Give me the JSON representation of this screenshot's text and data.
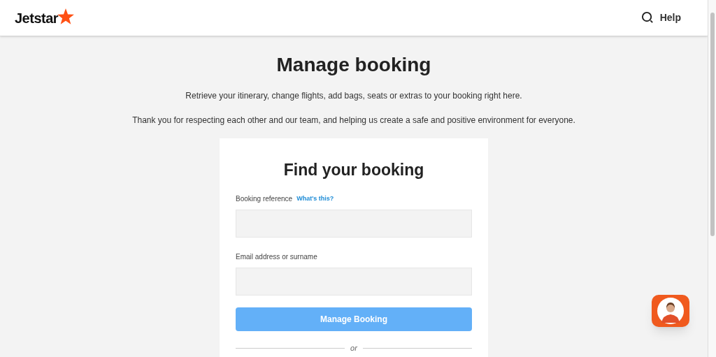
{
  "header": {
    "logo": "Jetstar",
    "help": "Help"
  },
  "page": {
    "title": "Manage booking",
    "intro": "Retrieve your itinerary, change flights, add bags, seats or extras to your booking right here.",
    "notice": "Thank you for respecting each other and our team, and helping us create a safe and positive environment for everyone."
  },
  "form": {
    "title": "Find your booking",
    "fields": [
      {
        "label": "Booking reference",
        "link": "What's this?"
      },
      {
        "label": "Email address or surname"
      }
    ],
    "button": "Manage Booking",
    "divider": "or"
  }
}
